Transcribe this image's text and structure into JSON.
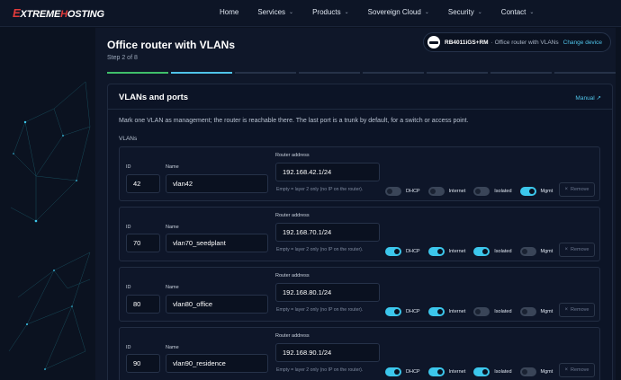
{
  "header": {
    "logo": {
      "prefix": "E",
      "part1": "XTREME",
      "part2": "HOSTING"
    },
    "nav": [
      {
        "label": "Home",
        "has_dropdown": false
      },
      {
        "label": "Services",
        "has_dropdown": true
      },
      {
        "label": "Products",
        "has_dropdown": true
      },
      {
        "label": "Sovereign Cloud",
        "has_dropdown": true
      },
      {
        "label": "Security",
        "has_dropdown": true
      },
      {
        "label": "Contact",
        "has_dropdown": true
      }
    ]
  },
  "page": {
    "title": "Office router with VLANs",
    "step": "Step 2 of 8",
    "device": {
      "model": "RB4011iGS+RM",
      "description": "· Office router with VLANs",
      "change_label": "Change device"
    },
    "progress": {
      "total_steps": 8,
      "current_step": 2
    }
  },
  "card": {
    "title": "VLANs and ports",
    "manual_label": "Manual ↗",
    "description": "Mark one VLAN as management; the router is reachable there. The last port is a trunk by default, for a switch or access point.",
    "vlans_label": "VLANs",
    "labels": {
      "id": "ID",
      "name": "Name",
      "router_address": "Router address",
      "hint": "Empty = layer 2 only (no IP on the router).",
      "dhcp": "DHCP",
      "internet": "Internet",
      "isolated": "Isolated",
      "mgmt": "Mgmt",
      "remove": "Remove"
    },
    "vlans": [
      {
        "id": "42",
        "name": "vlan42",
        "address": "192.168.42.1/24",
        "dhcp": false,
        "internet": false,
        "isolated": false,
        "mgmt": true,
        "remove_enabled": false
      },
      {
        "id": "70",
        "name": "vlan70_seedplant",
        "address": "192.168.70.1/24",
        "dhcp": true,
        "internet": true,
        "isolated": true,
        "mgmt": false,
        "remove_enabled": false
      },
      {
        "id": "80",
        "name": "vlan80_office",
        "address": "192.168.80.1/24",
        "dhcp": true,
        "internet": true,
        "isolated": false,
        "mgmt": false,
        "remove_enabled": false
      },
      {
        "id": "90",
        "name": "vlan90_residence",
        "address": "192.168.90.1/24",
        "dhcp": true,
        "internet": true,
        "isolated": true,
        "mgmt": false,
        "remove_enabled": false
      }
    ]
  },
  "colors": {
    "background": "#0b1220",
    "accent": "#4fc3e8",
    "toggle_on": "#3cc7ec",
    "progress_done": "#3fbf6a",
    "logo_red": "#e23b3b"
  }
}
